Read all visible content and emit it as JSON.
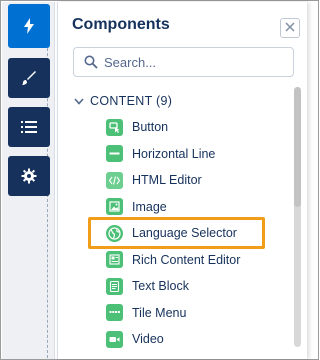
{
  "panel": {
    "title": "Components",
    "close_icon": "close-icon"
  },
  "rail": {
    "buttons": [
      {
        "icon": "lightning-icon",
        "active": true
      },
      {
        "icon": "brush-icon",
        "active": false
      },
      {
        "icon": "list-icon",
        "active": false
      },
      {
        "icon": "gear-icon",
        "active": false
      }
    ]
  },
  "search": {
    "placeholder": "Search..."
  },
  "section": {
    "label": "CONTENT (9)",
    "expanded": true
  },
  "items": [
    {
      "label": "Button",
      "icon": "button-icon"
    },
    {
      "label": "Horizontal Line",
      "icon": "horizontal-line-icon"
    },
    {
      "label": "HTML Editor",
      "icon": "html-code-icon"
    },
    {
      "label": "Image",
      "icon": "image-icon"
    },
    {
      "label": "Language Selector",
      "icon": "globe-icon",
      "highlighted": true
    },
    {
      "label": "Rich Content Editor",
      "icon": "rich-content-icon"
    },
    {
      "label": "Text Block",
      "icon": "text-block-icon"
    },
    {
      "label": "Tile Menu",
      "icon": "tile-menu-icon"
    },
    {
      "label": "Video",
      "icon": "video-icon"
    }
  ],
  "colors": {
    "accent": "#0070d2",
    "rail_dark": "#16325c",
    "item_icon": "#4bc076",
    "highlight": "#f19d1a",
    "text": "#16325c"
  }
}
